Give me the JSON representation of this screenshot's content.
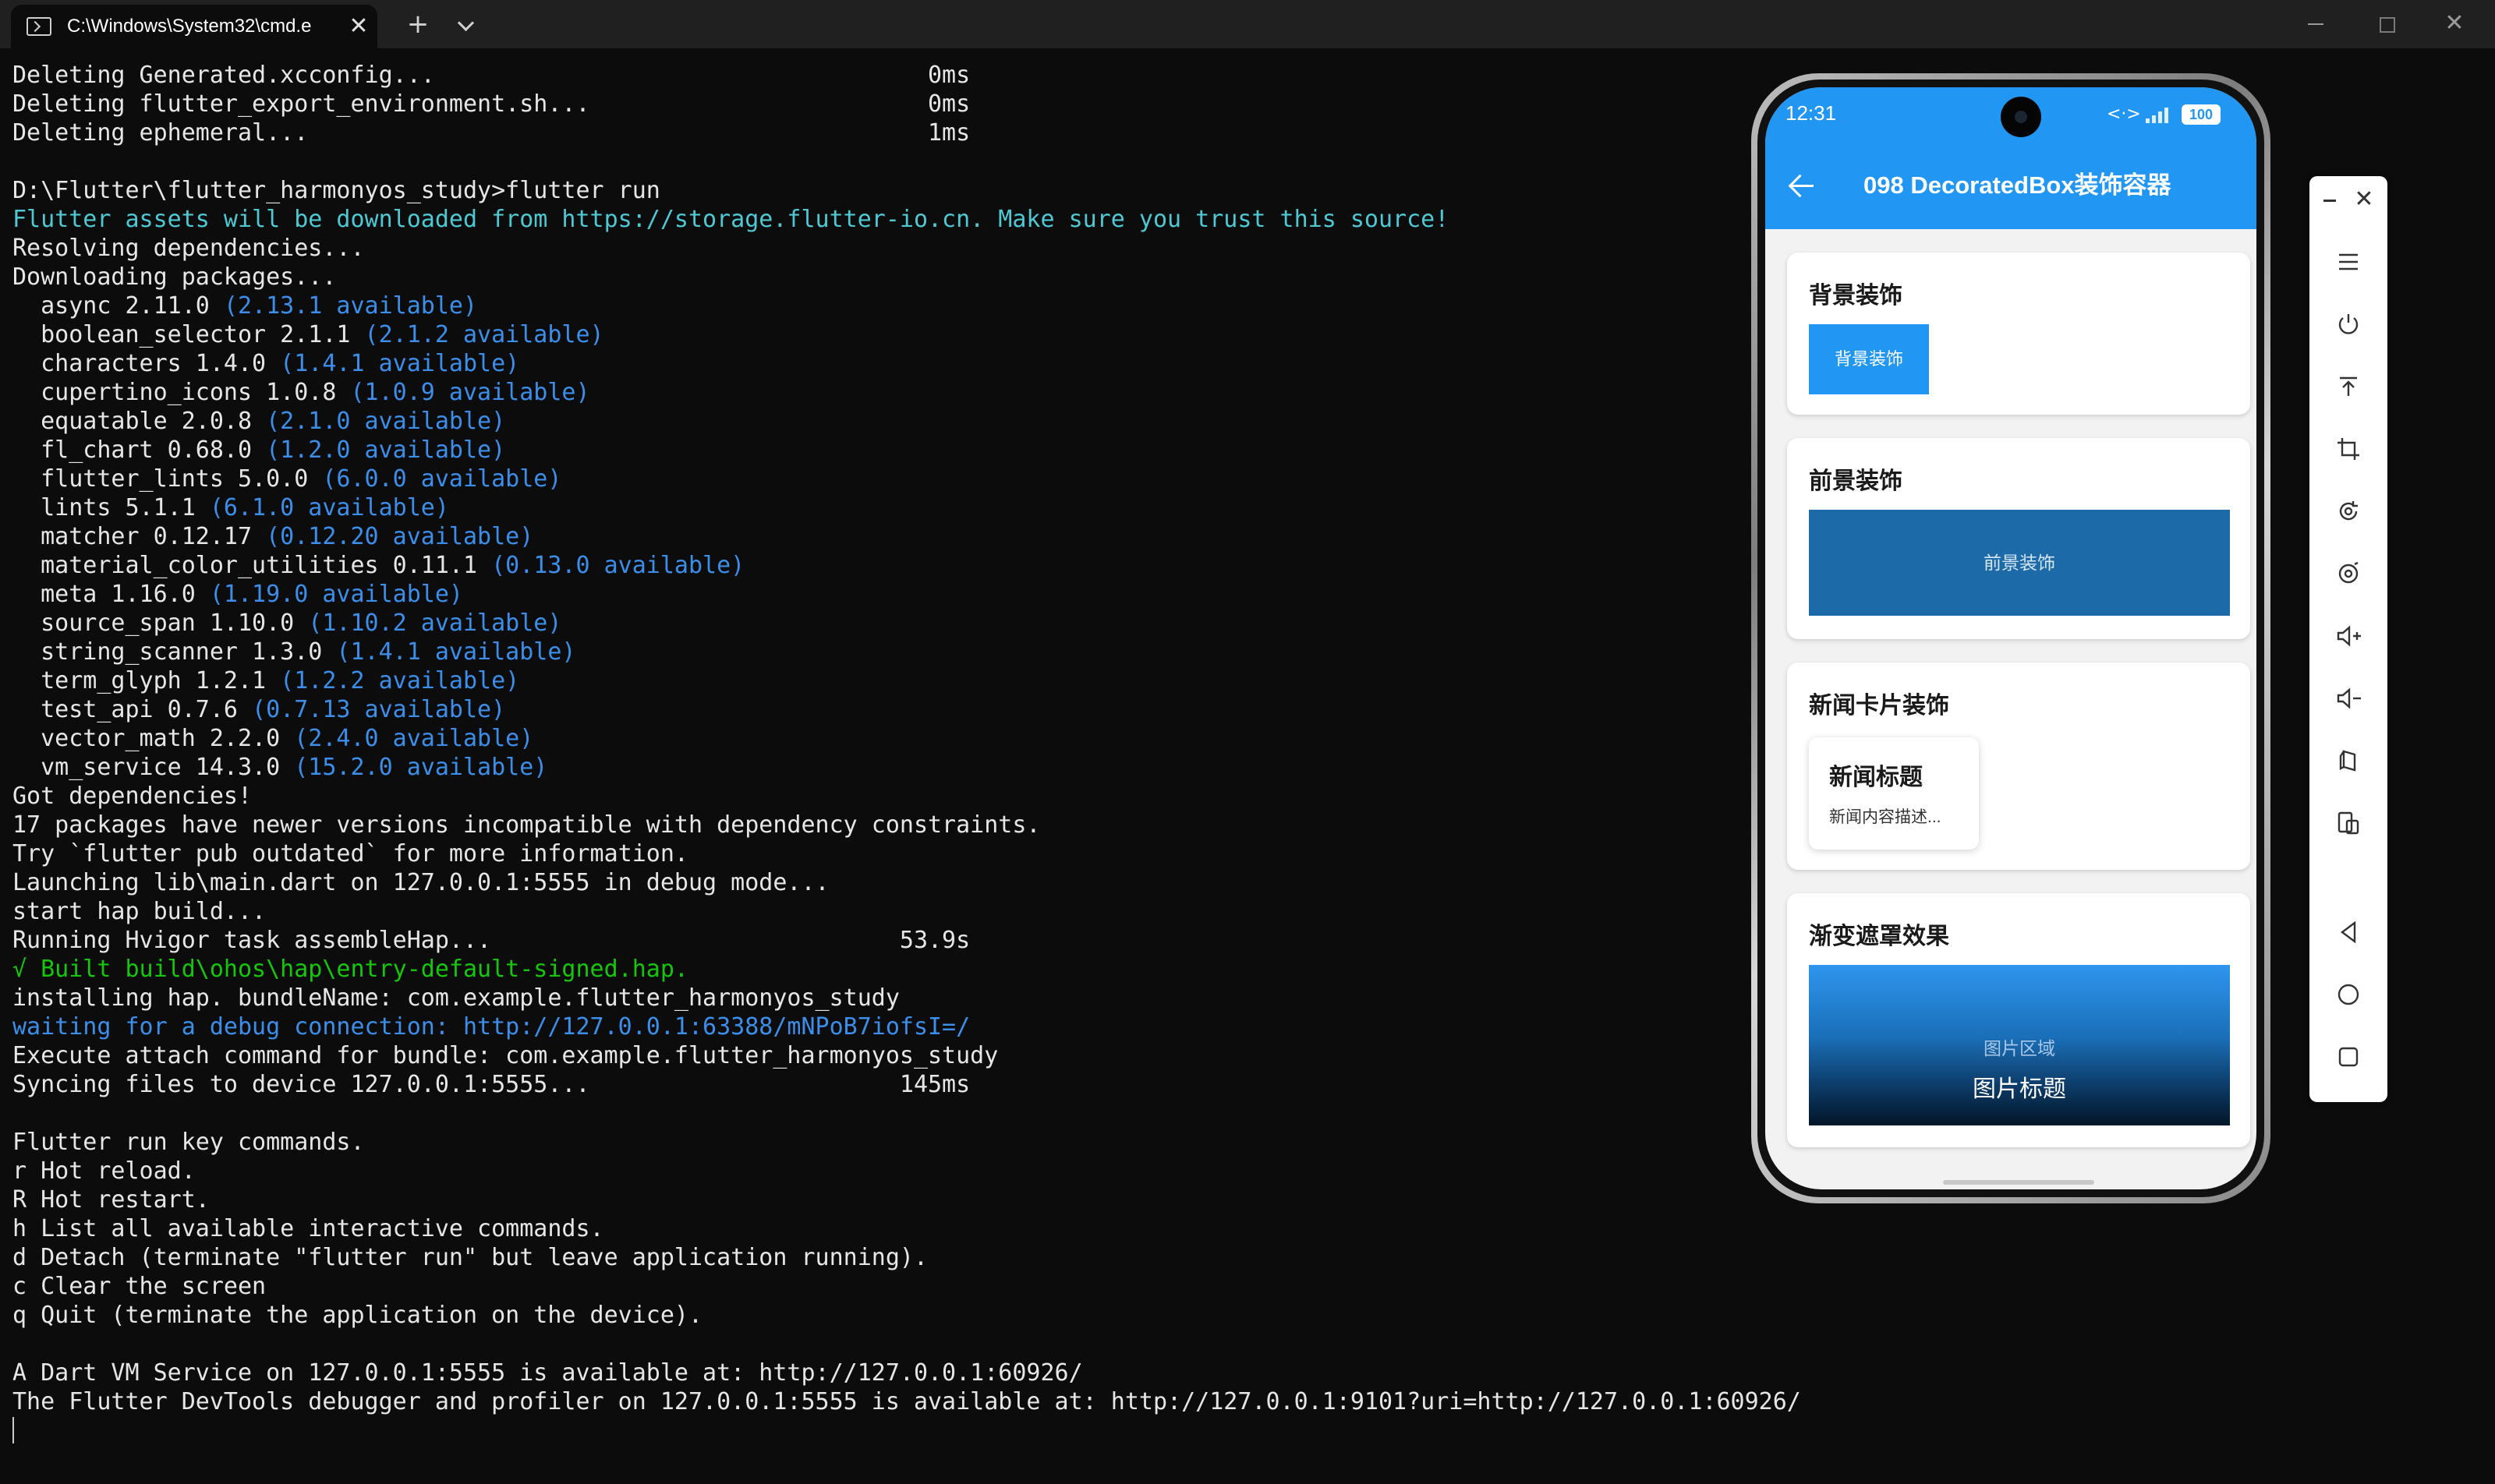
{
  "window": {
    "tab_title": "C:\\Windows\\System32\\cmd.e",
    "tab_close": "✕",
    "new_tab": "+",
    "close": "✕"
  },
  "terminal": {
    "lines": [
      {
        "text": "Deleting Generated.xcconfig...                                   0ms",
        "color": "default"
      },
      {
        "text": "Deleting flutter_export_environment.sh...                        0ms",
        "color": "default"
      },
      {
        "text": "Deleting ephemeral...                                            1ms",
        "color": "default"
      },
      {
        "text": "",
        "color": "default"
      },
      {
        "text": "D:\\Flutter\\flutter_harmonyos_study>flutter run",
        "color": "default"
      },
      {
        "text": "Flutter assets will be downloaded from https://storage.flutter-io.cn. Make sure you trust this source!",
        "color": "cyan"
      },
      {
        "text": "Resolving dependencies...",
        "color": "default"
      },
      {
        "text": "Downloading packages...",
        "color": "default"
      },
      {
        "text": "  async 2.11.0 ",
        "avail": "(2.13.1 available)"
      },
      {
        "text": "  boolean_selector 2.1.1 ",
        "avail": "(2.1.2 available)"
      },
      {
        "text": "  characters 1.4.0 ",
        "avail": "(1.4.1 available)"
      },
      {
        "text": "  cupertino_icons 1.0.8 ",
        "avail": "(1.0.9 available)"
      },
      {
        "text": "  equatable 2.0.8 ",
        "avail": "(2.1.0 available)"
      },
      {
        "text": "  fl_chart 0.68.0 ",
        "avail": "(1.2.0 available)"
      },
      {
        "text": "  flutter_lints 5.0.0 ",
        "avail": "(6.0.0 available)"
      },
      {
        "text": "  lints 5.1.1 ",
        "avail": "(6.1.0 available)"
      },
      {
        "text": "  matcher 0.12.17 ",
        "avail": "(0.12.20 available)"
      },
      {
        "text": "  material_color_utilities 0.11.1 ",
        "avail": "(0.13.0 available)"
      },
      {
        "text": "  meta 1.16.0 ",
        "avail": "(1.19.0 available)"
      },
      {
        "text": "  source_span 1.10.0 ",
        "avail": "(1.10.2 available)"
      },
      {
        "text": "  string_scanner 1.3.0 ",
        "avail": "(1.4.1 available)"
      },
      {
        "text": "  term_glyph 1.2.1 ",
        "avail": "(1.2.2 available)"
      },
      {
        "text": "  test_api 0.7.6 ",
        "avail": "(0.7.13 available)"
      },
      {
        "text": "  vector_math 2.2.0 ",
        "avail": "(2.4.0 available)"
      },
      {
        "text": "  vm_service 14.3.0 ",
        "avail": "(15.2.0 available)"
      },
      {
        "text": "Got dependencies!",
        "color": "default"
      },
      {
        "text": "17 packages have newer versions incompatible with dependency constraints.",
        "color": "default"
      },
      {
        "text": "Try `flutter pub outdated` for more information.",
        "color": "default"
      },
      {
        "text": "Launching lib\\main.dart on 127.0.0.1:5555 in debug mode...",
        "color": "default"
      },
      {
        "text": "start hap build...",
        "color": "default"
      },
      {
        "text": "Running Hvigor task assembleHap...                             53.9s",
        "color": "default"
      },
      {
        "text": "√ Built build\\ohos\\hap\\entry-default-signed.hap.",
        "color": "green"
      },
      {
        "text": "installing hap. bundleName: com.example.flutter_harmonyos_study",
        "color": "default"
      },
      {
        "text": "waiting for a debug connection: http://127.0.0.1:63388/mNPoB7iofsI=/",
        "color": "blue"
      },
      {
        "text": "Execute attach command for bundle: com.example.flutter_harmonyos_study",
        "color": "default"
      },
      {
        "text": "Syncing files to device 127.0.0.1:5555...                      145ms",
        "color": "default"
      },
      {
        "text": "",
        "color": "default"
      },
      {
        "text": "Flutter run key commands.",
        "color": "default"
      },
      {
        "text": "r Hot reload.",
        "color": "default"
      },
      {
        "text": "R Hot restart.",
        "color": "default"
      },
      {
        "text": "h List all available interactive commands.",
        "color": "default"
      },
      {
        "text": "d Detach (terminate \"flutter run\" but leave application running).",
        "color": "default"
      },
      {
        "text": "c Clear the screen",
        "color": "default"
      },
      {
        "text": "q Quit (terminate the application on the device).",
        "color": "default"
      },
      {
        "text": "",
        "color": "default"
      },
      {
        "text": "A Dart VM Service on 127.0.0.1:5555 is available at: http://127.0.0.1:60926/",
        "color": "default"
      },
      {
        "text": "The Flutter DevTools debugger and profiler on 127.0.0.1:5555 is available at: http://127.0.0.1:9101?uri=http://127.0.0.1:60926/",
        "color": "default"
      }
    ]
  },
  "phone": {
    "status": {
      "time": "12:31",
      "net_icon": "<·>",
      "battery": "100"
    },
    "appbar": {
      "title": "098 DecoratedBox装饰容器",
      "back_icon": "arrow-left-icon"
    },
    "cards": {
      "background": {
        "title": "背景装饰",
        "box_label": "背景装饰"
      },
      "foreground": {
        "title": "前景装饰",
        "box_label": "前景装饰"
      },
      "news": {
        "title": "新闻卡片装饰",
        "news_title": "新闻标题",
        "news_desc": "新闻内容描述..."
      },
      "gradient": {
        "title": "渐变遮罩效果",
        "area_label": "图片区域",
        "image_title": "图片标题"
      }
    }
  },
  "toolbar": {
    "close": "✕",
    "icons": [
      "menu-icon",
      "power-icon",
      "pin-top-icon",
      "crop-icon",
      "rotate-icon",
      "screenshot-icon",
      "volume-up-icon",
      "volume-down-icon",
      "fold-icon",
      "multi-device-icon",
      "nav-back-icon",
      "nav-home-icon",
      "nav-recent-icon"
    ]
  },
  "colors": {
    "terminal_bg": "#0c0c0c",
    "terminal_text": "#e6e6e6",
    "cyan": "#4ec9d4",
    "green": "#16c60c",
    "blue": "#3b8eea",
    "app_primary": "#2196f3"
  }
}
